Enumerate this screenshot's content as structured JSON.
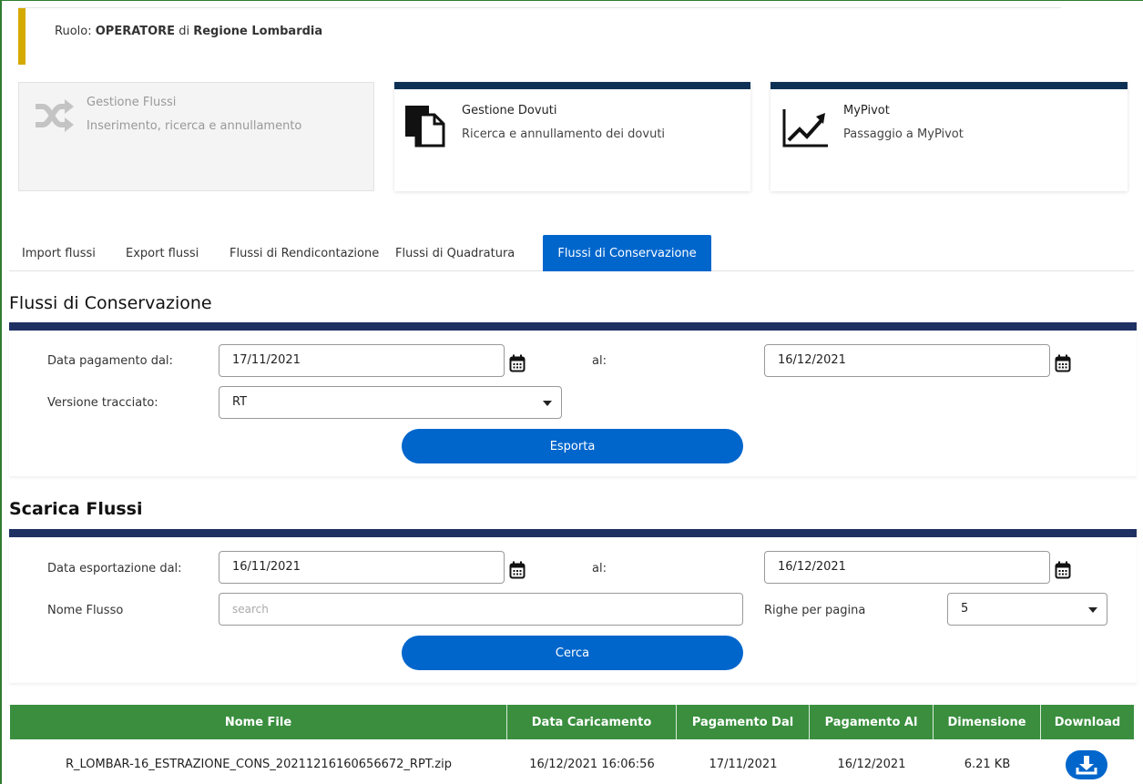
{
  "role": {
    "prefix": "Ruolo:",
    "role_name": "OPERATORE",
    "connector": "di",
    "entity": "Regione Lombardia"
  },
  "cards": [
    {
      "title": "Gestione Flussi",
      "subtitle": "Inserimento, ricerca e annullamento",
      "icon": "shuffle-icon",
      "state": "disabled"
    },
    {
      "title": "Gestione Dovuti",
      "subtitle": "Ricerca e annullamento dei dovuti",
      "icon": "documents-icon",
      "state": "enabled"
    },
    {
      "title": "MyPivot",
      "subtitle": "Passaggio a MyPivot",
      "icon": "trending-chart-icon",
      "state": "enabled"
    }
  ],
  "tabs": [
    {
      "label": "Import flussi"
    },
    {
      "label": "Export flussi"
    },
    {
      "label": "Flussi di Rendicontazione"
    },
    {
      "label": "Flussi di Quadratura"
    },
    {
      "label": "Flussi di Conservazione",
      "active": true
    }
  ],
  "conservazione": {
    "title": "Flussi di Conservazione",
    "date_from_label": "Data pagamento dal:",
    "date_from_value": "17/11/2021",
    "date_to_label": "al:",
    "date_to_value": "16/12/2021",
    "version_label": "Versione tracciato:",
    "version_value": "RT",
    "export_button": "Esporta"
  },
  "scarica": {
    "title": "Scarica Flussi",
    "date_from_label": "Data esportazione dal:",
    "date_from_value": "16/11/2021",
    "date_to_label": "al:",
    "date_to_value": "16/12/2021",
    "name_label": "Nome Flusso",
    "name_placeholder": "search",
    "rows_label": "Righe per pagina",
    "rows_value": "5",
    "search_button": "Cerca"
  },
  "table": {
    "headers": [
      "Nome File",
      "Data Caricamento",
      "Pagamento Dal",
      "Pagamento Al",
      "Dimensione",
      "Download"
    ],
    "rows": [
      {
        "file": "R_LOMBAR-16_ESTRAZIONE_CONS_20211216160656672_RPT.zip",
        "uploaded": "16/12/2021 16:06:56",
        "pay_from": "17/11/2021",
        "pay_to": "16/12/2021",
        "size": "6.21 KB",
        "download_icon": "download-icon"
      }
    ]
  },
  "colors": {
    "accent_blue": "#0066cc",
    "section_bar": "#1f3063",
    "card_top": "#0c3155",
    "table_header": "#3a8e3e",
    "role_accent": "#d4a900"
  }
}
